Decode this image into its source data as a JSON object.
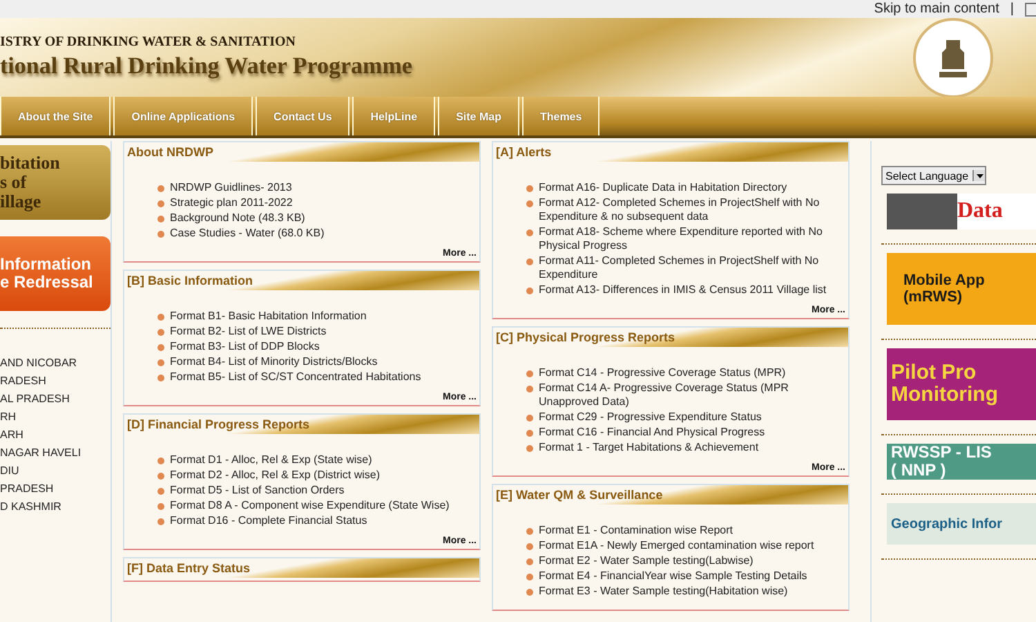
{
  "top_bar": {
    "skip_link": "Skip to main content",
    "separator": "|"
  },
  "header": {
    "ministry": "ISTRY OF DRINKING WATER & SANITATION",
    "programme": "tional Rural Drinking Water Programme"
  },
  "nav": [
    "About the Site",
    "Online Applications",
    "Contact Us",
    "HelpLine",
    "Site Map",
    "Themes"
  ],
  "left_banners": [
    {
      "kind": "search",
      "lines": [
        "bitation",
        "s of",
        "illage"
      ]
    },
    {
      "kind": "grievance",
      "lines": [
        "Information",
        "e Redressal"
      ]
    }
  ],
  "states": [
    "AND NICOBAR",
    "RADESH",
    "AL PRADESH",
    "RH",
    "ARH",
    "NAGAR HAVELI",
    "DIU",
    "PRADESH",
    "D KASHMIR"
  ],
  "columns": [
    [
      {
        "title": "About NRDWP",
        "items": [
          "NRDWP Guidlines- 2013",
          "Strategic plan 2011-2022",
          "Background Note (48.3 KB)",
          "Case Studies - Water (68.0 KB)"
        ],
        "more": "More ..."
      },
      {
        "title": "[B] Basic Information",
        "items": [
          "Format B1- Basic Habitation Information",
          "Format B2- List of LWE Districts",
          "Format B3- List of DDP Blocks",
          "Format B4- List of Minority Districts/Blocks",
          "Format B5- List of SC/ST Concentrated Habitations"
        ],
        "more": "More ..."
      },
      {
        "title": "[D] Financial Progress Reports",
        "items": [
          "Format D1 - Alloc, Rel & Exp (State wise)",
          "Format D2 - Alloc, Rel & Exp (District wise)",
          "Format D5 - List of Sanction Orders",
          "Format D8 A - Component wise Expenditure (State Wise)",
          "Format D16 - Complete Financial Status"
        ],
        "more": "More ..."
      },
      {
        "title": "[F] Data Entry Status"
      }
    ],
    [
      {
        "title": "[A] Alerts",
        "items": [
          "Format A16- Duplicate Data in Habitation Directory",
          "Format A12- Completed Schemes in ProjectShelf with No Expenditure & no subsequent data",
          "Format A18- Scheme where Expenditure reported with No Physical Progress",
          "Format A11- Completed Schemes in ProjectShelf with No Expenditure",
          "Format A13- Differences in IMIS & Census 2011 Village list"
        ],
        "more": "More ..."
      },
      {
        "title": "[C] Physical Progress Reports",
        "items": [
          "Format C14 - Progressive Coverage Status (MPR)",
          "Format C14 A- Progressive Coverage Status (MPR Unapproved Data)",
          "Format C29 - Progressive Expenditure Status",
          "Format C16 - Financial And Physical Progress",
          "Format 1 - Target Habitations & Achievement"
        ],
        "more": "More ..."
      },
      {
        "title": "[E] Water QM & Surveillance",
        "items": [
          "Format E1 - Contamination wise Report",
          "Format E1A - Newly Emerged contamination wise report",
          "Format E2 - Water Sample testing(Labwise)",
          "Format E4 - FinancialYear wise Sample Testing Details",
          "Format E3 - Water Sample testing(Habitation wise)"
        ]
      }
    ]
  ],
  "language_select": "Select Language",
  "right_banners": [
    {
      "kind": "data",
      "lines": [
        "Data"
      ]
    },
    {
      "kind": "mobile",
      "lines": [
        "Mobile App",
        "(mRWS)"
      ]
    },
    {
      "kind": "pilot",
      "lines": [
        "Pilot Pro",
        "Monitoring"
      ]
    },
    {
      "kind": "rwssp",
      "lines": [
        "RWSSP - LIS",
        "( NNP )"
      ]
    },
    {
      "kind": "geo",
      "lines": [
        "Geographic Infor"
      ]
    }
  ]
}
